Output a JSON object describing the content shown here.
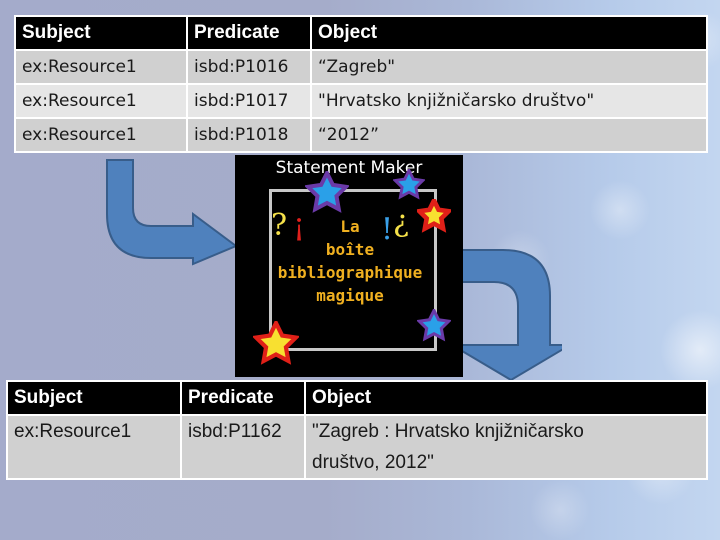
{
  "top_table": {
    "headers": [
      "Subject",
      "Predicate",
      "Object"
    ],
    "rows": [
      [
        "ex:Resource1",
        "isbd:P1016",
        "“Zagreb\""
      ],
      [
        "ex:Resource1",
        "isbd:P1017",
        "\"Hrvatsko knjižničarsko društvo\""
      ],
      [
        "ex:Resource1",
        "isbd:P1018",
        "“2012”"
      ]
    ]
  },
  "statement_maker": {
    "title": "Statement Maker",
    "text_lines": [
      "La",
      "boîte",
      "bibliographique",
      "magique"
    ],
    "glyphs": [
      "?",
      "¡",
      "!",
      "¿"
    ],
    "colors": {
      "text": "#f0b020",
      "glyph_yellow": "#f5e14a",
      "glyph_red": "#e0201c",
      "glyph_blue": "#3aa0e8"
    }
  },
  "bottom_table": {
    "headers": [
      "Subject",
      "Predicate",
      "Object"
    ],
    "rows": [
      [
        "ex:Resource1",
        "isbd:P1162",
        "\"Zagreb : Hrvatsko knjižničarsko društvo, 2012\""
      ]
    ]
  },
  "colors": {
    "arrow_fill": "#4f81bd",
    "arrow_stroke": "#385d8a",
    "header_bg": "#000000",
    "row_odd": "#d0d0d0",
    "row_even": "#e6e6e6"
  }
}
